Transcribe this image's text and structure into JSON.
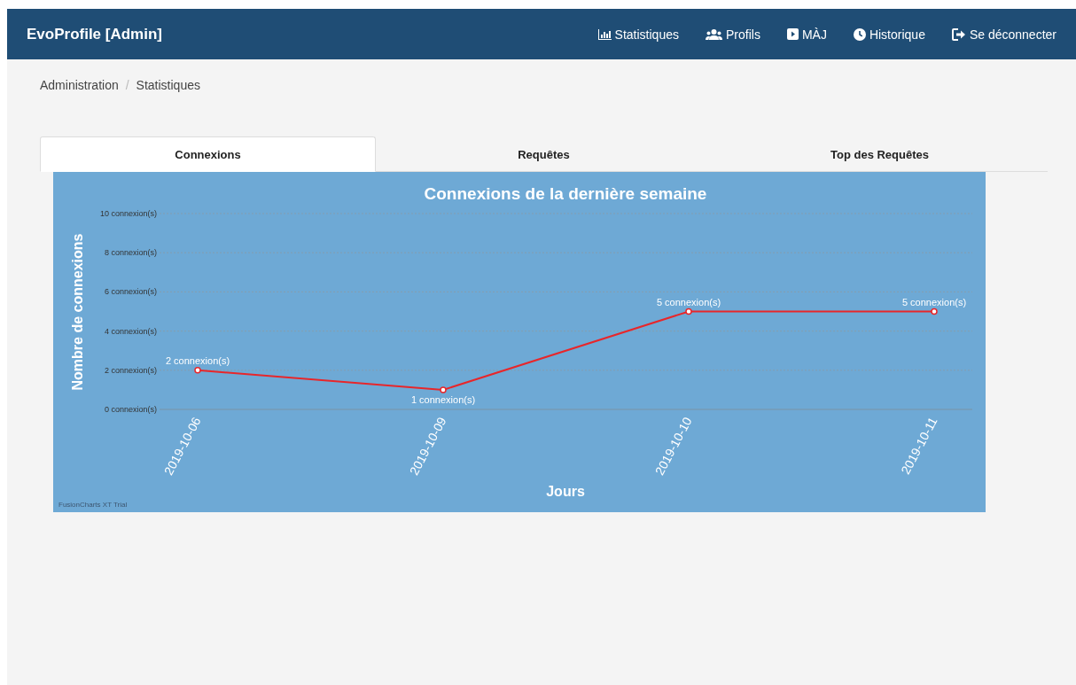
{
  "navbar": {
    "brand": "EvoProfile [Admin]",
    "links": [
      {
        "label": "Statistiques"
      },
      {
        "label": "Profils"
      },
      {
        "label": "MÀJ"
      },
      {
        "label": "Historique"
      },
      {
        "label": "Se déconnecter"
      }
    ]
  },
  "breadcrumb": {
    "separator": "/",
    "items": [
      "Administration",
      "Statistiques"
    ]
  },
  "tabs": [
    {
      "label": "Connexions",
      "selected": true
    },
    {
      "label": "Requêtes",
      "selected": false
    },
    {
      "label": "Top des Requêtes",
      "selected": false
    }
  ],
  "chart": {
    "watermark": "FusionCharts XT Trial",
    "chart_data": {
      "type": "line",
      "title": "Connexions de la dernière semaine",
      "xlabel": "Jours",
      "ylabel": "Nombre de connexions",
      "categories": [
        "2019-10-06",
        "2019-10-09",
        "2019-10-10",
        "2019-10-11"
      ],
      "grid": true,
      "series": [
        {
          "color": "#e8262a",
          "marker": true,
          "values": [
            2,
            1,
            5,
            5
          ]
        }
      ],
      "ylim": [
        0,
        10
      ],
      "yticks": [
        {
          "value": 0,
          "label": "0 connexion(s)"
        },
        {
          "value": 2,
          "label": "2 connexion(s)"
        },
        {
          "value": 4,
          "label": "4 connexion(s)"
        },
        {
          "value": 6,
          "label": "6 connexion(s)"
        },
        {
          "value": 8,
          "label": "8 connexion(s)"
        },
        {
          "value": 10,
          "label": "10 connexion(s)"
        }
      ],
      "value_labels": [
        "2 connexion(s)",
        "1 connexion(s)",
        "5 connexion(s)",
        "5 connexion(s)"
      ]
    }
  }
}
